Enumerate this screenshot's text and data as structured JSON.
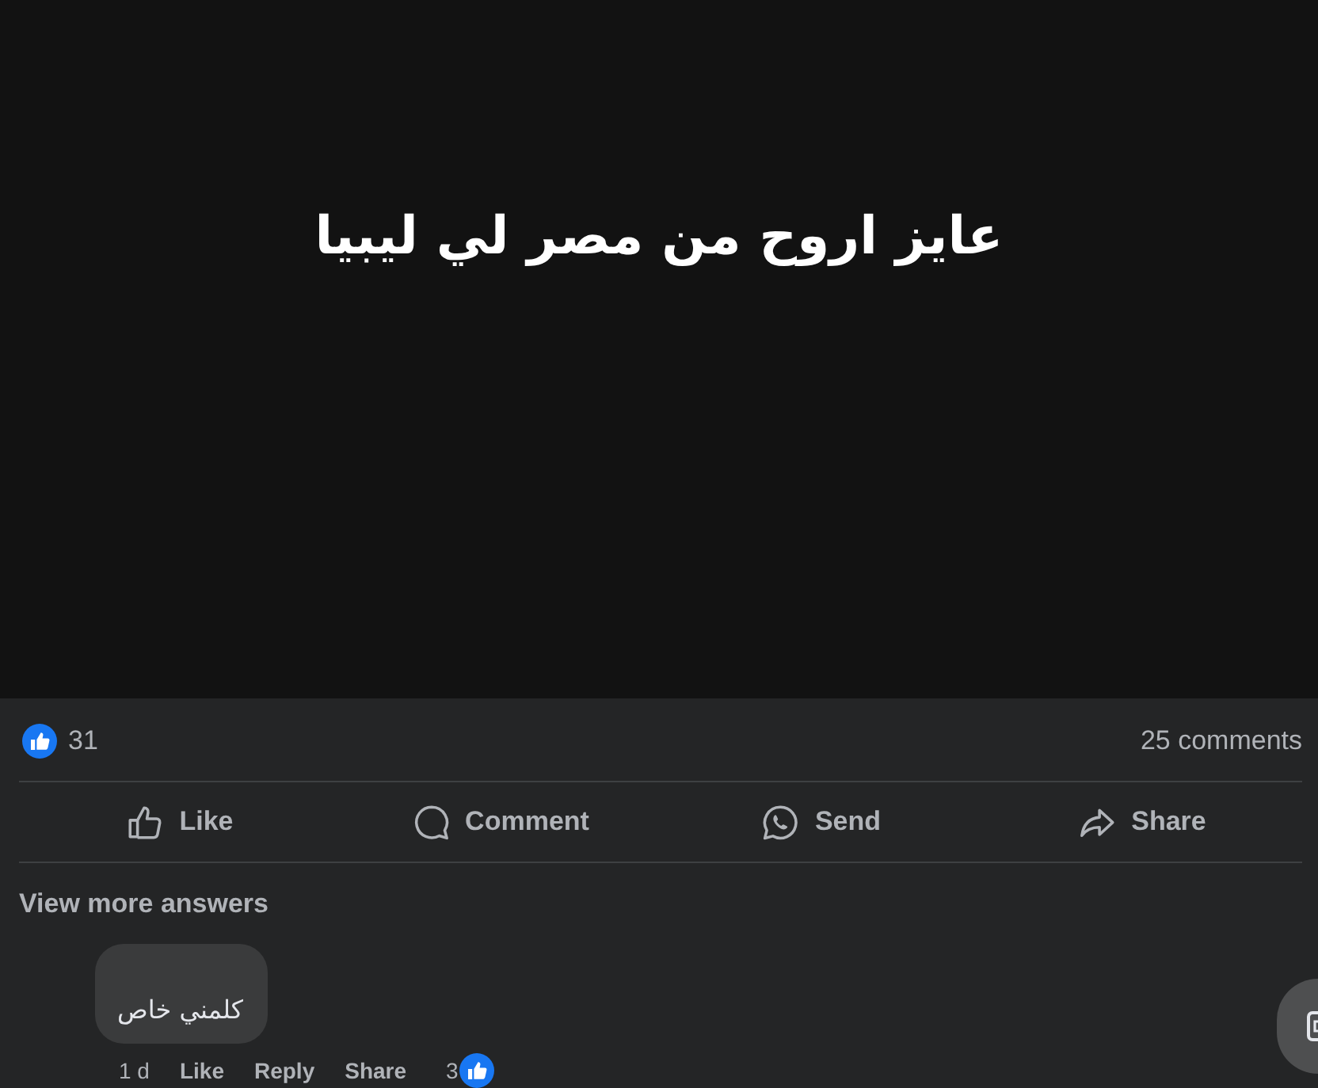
{
  "post": {
    "text": "عايز اروح من مصر لي ليبيا"
  },
  "reactions": {
    "count": "31",
    "comments": "25 comments"
  },
  "actions": [
    {
      "kind": "like",
      "label": "Like"
    },
    {
      "kind": "comment",
      "label": "Comment"
    },
    {
      "kind": "send",
      "label": "Send"
    },
    {
      "kind": "share",
      "label": "Share"
    }
  ],
  "view_more": "View more answers",
  "comment": {
    "text": "كلمني خاص",
    "time": "1 d",
    "actions": [
      "Like",
      "Reply",
      "Share"
    ],
    "reaction_count": "3"
  }
}
